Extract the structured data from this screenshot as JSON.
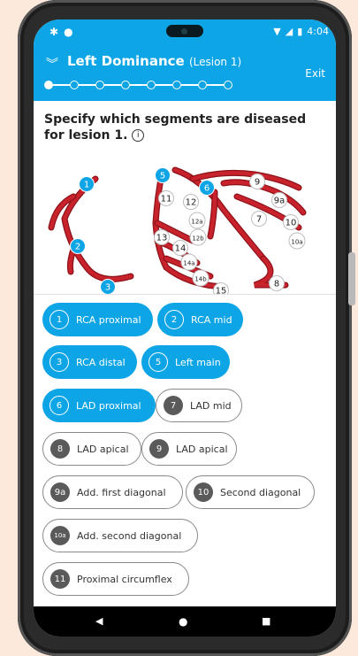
{
  "status": {
    "time": "4:04"
  },
  "header": {
    "title": "Left Dominance",
    "subtitle": "(Lesion 1)",
    "exit_label": "Exit",
    "steps_total": 8,
    "current_step": 1
  },
  "question": "Specify which segments are diseased for lesion 1.",
  "diagram_labels": [
    "1",
    "2",
    "3",
    "5",
    "6",
    "11",
    "12",
    "12a",
    "12b",
    "13",
    "14",
    "14a",
    "14b",
    "15",
    "9",
    "9a",
    "7",
    "10",
    "10a",
    "8"
  ],
  "segments": [
    {
      "num": "1",
      "label": "RCA proximal",
      "selected": true
    },
    {
      "num": "2",
      "label": "RCA mid",
      "selected": true
    },
    {
      "num": "3",
      "label": "RCA distal",
      "selected": true
    },
    {
      "num": "5",
      "label": "Left main",
      "selected": true
    },
    {
      "num": "6",
      "label": "LAD proximal",
      "selected": true
    },
    {
      "num": "7",
      "label": "LAD mid",
      "selected": false
    },
    {
      "num": "8",
      "label": "LAD apical",
      "selected": false
    },
    {
      "num": "9",
      "label": "LAD apical",
      "selected": false
    },
    {
      "num": "9a",
      "label": "Add. first diagonal",
      "selected": false
    },
    {
      "num": "10",
      "label": "Second diagonal",
      "selected": false
    },
    {
      "num": "10a",
      "label": "Add. second diagonal",
      "selected": false
    },
    {
      "num": "11",
      "label": "Proximal circumflex",
      "selected": false
    }
  ],
  "colors": {
    "accent": "#0ea5e6",
    "vessel": "#c8232c",
    "vessel_dark": "#8f1219"
  }
}
